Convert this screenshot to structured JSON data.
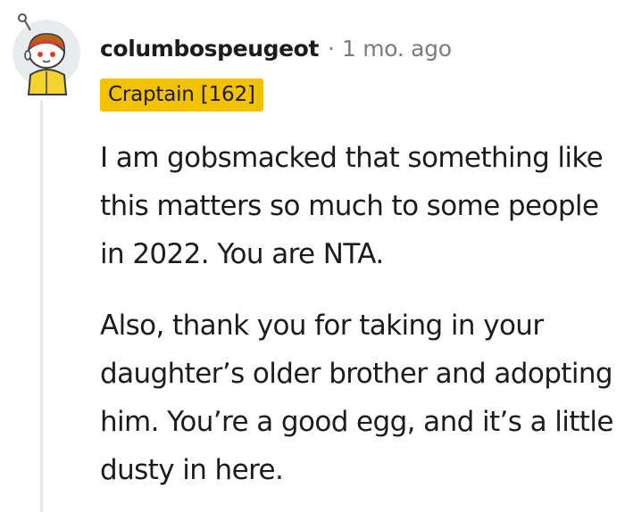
{
  "comment": {
    "username": "columbospeugeot",
    "separator": "·",
    "timestamp": "1 mo. ago",
    "flair": "Craptain [162]",
    "paragraphs": [
      "I am gobsmacked that something like this matters so much to some people in 2022. You are NTA.",
      "Also, thank you for taking in your daughter’s older brother and adopting him. You’re a good egg, and it’s a little dusty in here."
    ]
  },
  "colors": {
    "flair_bg": "#f2c200",
    "text": "#1c1c1c",
    "meta": "#7c7c7c",
    "thread_line": "#e6e7e8"
  },
  "icons": {
    "avatar": "snoo-avatar-icon"
  }
}
